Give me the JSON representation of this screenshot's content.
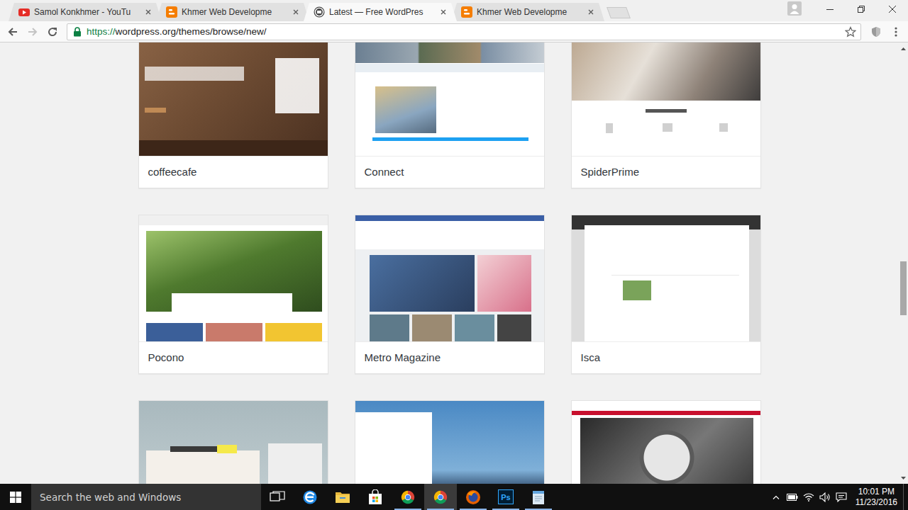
{
  "browser": {
    "tabs": [
      {
        "kind": "youtube",
        "label": "Samol Konkhmer - YouTu",
        "selected": false
      },
      {
        "kind": "blogger",
        "label": "Khmer Web Developme",
        "selected": false
      },
      {
        "kind": "wordpress",
        "label": "Latest — Free WordPres",
        "selected": true
      },
      {
        "kind": "blogger",
        "label": "Khmer Web Developme",
        "selected": false
      }
    ],
    "address": {
      "scheme": "https://",
      "rest": "wordpress.org/themes/browse/new/",
      "secure": true
    },
    "bookmarked": false,
    "forward_enabled": false
  },
  "themes": [
    {
      "name": "coffeecafe",
      "kind": "coffeecafe"
    },
    {
      "name": "Connect",
      "kind": "connect"
    },
    {
      "name": "SpiderPrime",
      "kind": "spiderprime"
    },
    {
      "name": "Pocono",
      "kind": "pocono"
    },
    {
      "name": "Metro Magazine",
      "kind": "metro"
    },
    {
      "name": "Isca",
      "kind": "isca"
    },
    {
      "kind": "scratchpad"
    },
    {
      "kind": "travel"
    },
    {
      "kind": "telescope"
    }
  ],
  "scrollbar": {
    "level": 0.57
  },
  "taskbar": {
    "search": {
      "placeholder": "Search the web and Windows"
    },
    "apps": [
      {
        "kind": "taskview",
        "running": false,
        "selected": false
      },
      {
        "kind": "edge",
        "running": false,
        "selected": false
      },
      {
        "kind": "explorer",
        "running": false,
        "selected": false
      },
      {
        "kind": "store",
        "running": false,
        "selected": false
      },
      {
        "kind": "chrome",
        "running": true,
        "selected": false
      },
      {
        "kind": "chrome",
        "running": true,
        "selected": true
      },
      {
        "kind": "firefox",
        "running": true,
        "selected": false
      },
      {
        "kind": "photoshop",
        "label": "Ps",
        "running": true,
        "selected": false
      },
      {
        "kind": "notepad",
        "running": true,
        "selected": false
      }
    ],
    "clock": {
      "time": "10:01 PM",
      "date": "11/23/2016"
    }
  }
}
